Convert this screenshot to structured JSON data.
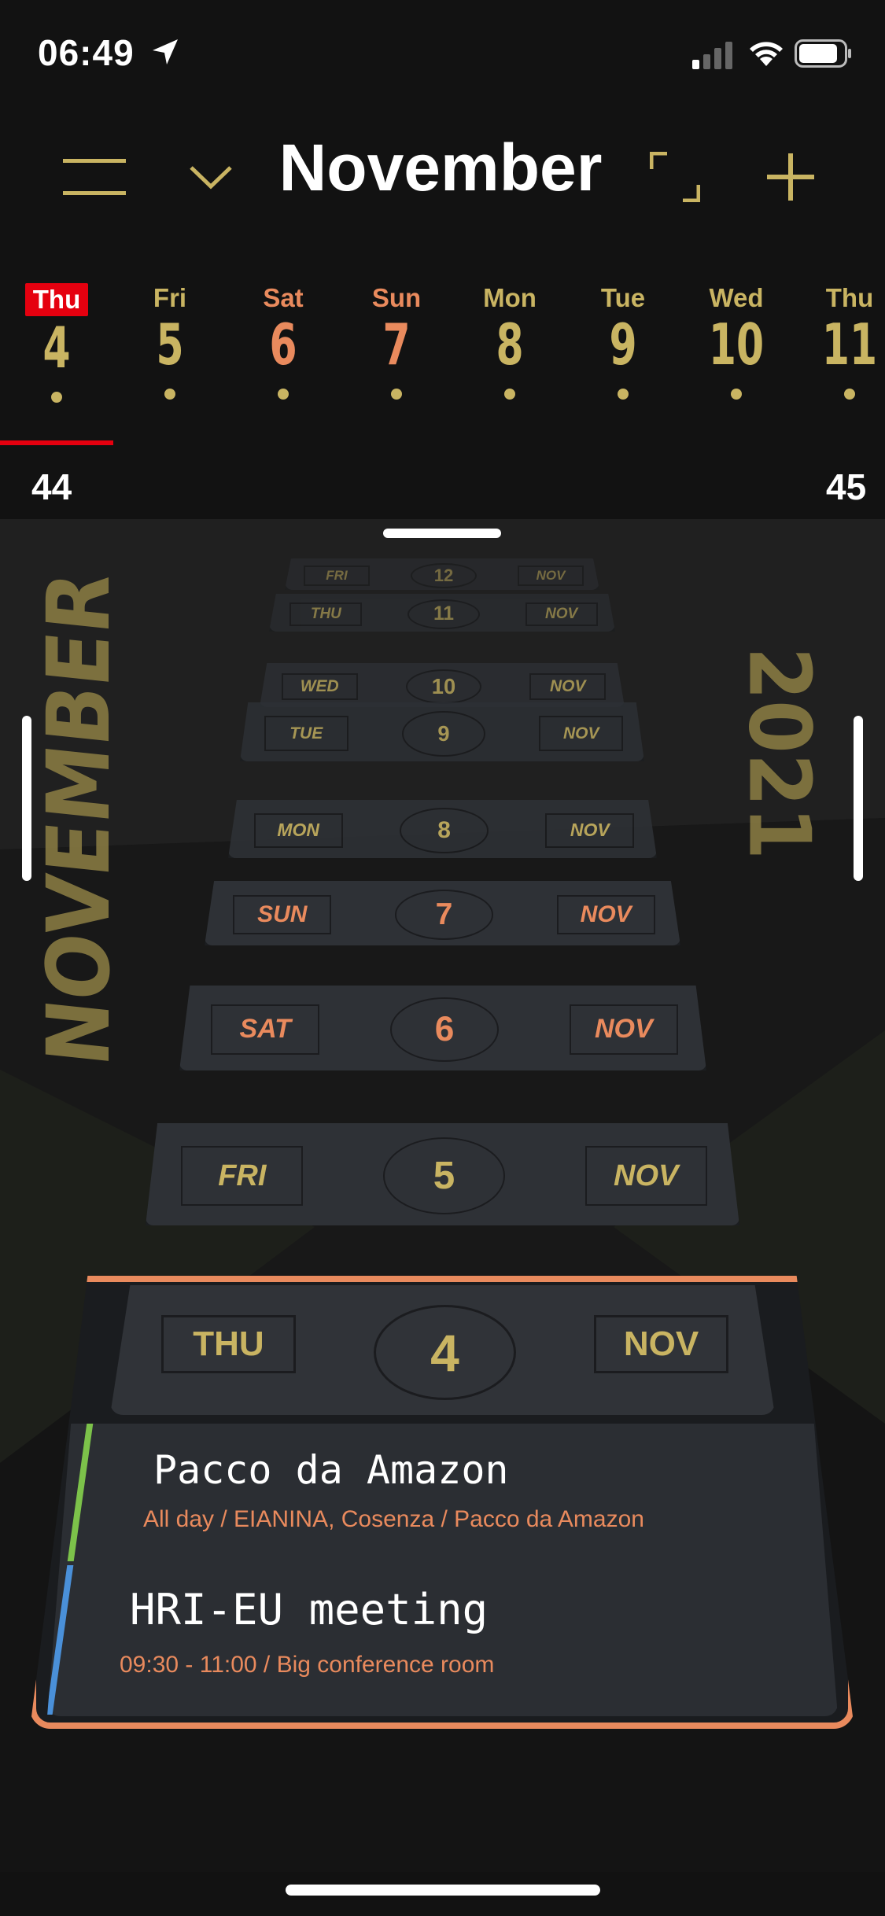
{
  "status_bar": {
    "time": "06:49",
    "location_icon": "location-arrow-icon",
    "signal_icon": "cellular-signal-icon",
    "wifi_icon": "wifi-icon",
    "battery_icon": "battery-icon"
  },
  "header": {
    "menu_icon": "menu-icon",
    "dropdown_icon": "chevron-down-icon",
    "title": "November",
    "expand_icon": "fullscreen-icon",
    "add_icon": "plus-icon"
  },
  "week_strip": {
    "days": [
      {
        "name": "Thu",
        "num": "4",
        "today": true
      },
      {
        "name": "Fri",
        "num": "5"
      },
      {
        "name": "Sat",
        "num": "6"
      },
      {
        "name": "Sun",
        "num": "7"
      },
      {
        "name": "Mon",
        "num": "8"
      },
      {
        "name": "Tue",
        "num": "9"
      },
      {
        "name": "Wed",
        "num": "10"
      },
      {
        "name": "Thu",
        "num": "11"
      }
    ],
    "week_left": "44",
    "week_right": "45"
  },
  "scene": {
    "side_month": "NOVEMBER",
    "side_year": "2021",
    "cards": [
      {
        "day": "FRI",
        "num": "12",
        "month": "NOV"
      },
      {
        "day": "THU",
        "num": "11",
        "month": "NOV"
      },
      {
        "day": "WED",
        "num": "10",
        "month": "NOV"
      },
      {
        "day": "TUE",
        "num": "9",
        "month": "NOV"
      },
      {
        "day": "MON",
        "num": "8",
        "month": "NOV"
      },
      {
        "day": "SUN",
        "num": "7",
        "month": "NOV"
      },
      {
        "day": "SAT",
        "num": "6",
        "month": "NOV"
      },
      {
        "day": "FRI",
        "num": "5",
        "month": "NOV"
      }
    ],
    "today": {
      "day": "THU",
      "num": "4",
      "month": "NOV",
      "events": [
        {
          "title": "Pacco da Amazon",
          "detail": "All day / EIANINA, Cosenza / Pacco da Amazon",
          "color": "#7cc24a"
        },
        {
          "title": "HRI-EU meeting",
          "detail": "09:30 - 11:00 / Big conference room",
          "color": "#4a90d9"
        }
      ]
    }
  },
  "colors": {
    "gold": "#c9b462",
    "orange": "#e98a5d",
    "today_red": "#e5000f"
  }
}
